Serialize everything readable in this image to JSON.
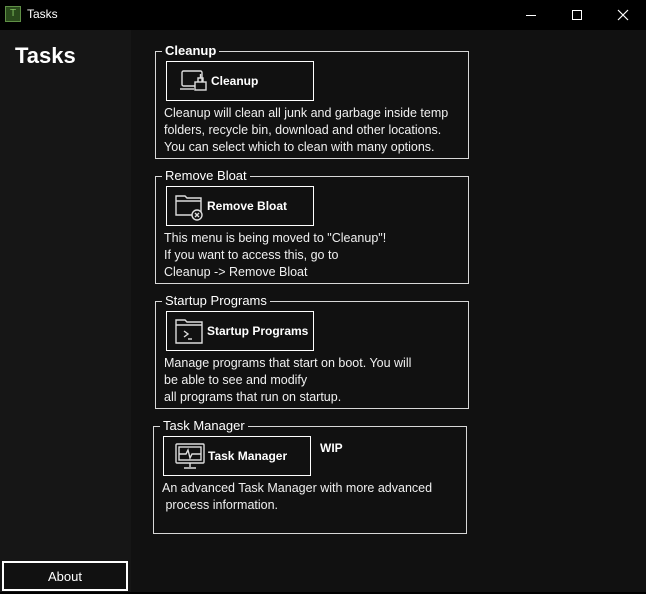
{
  "window": {
    "title": "Tasks",
    "app_icon_letter": "T",
    "controls": [
      "minimize",
      "maximize",
      "close"
    ]
  },
  "sidebar": {
    "title": "Tasks",
    "about_label": "About"
  },
  "groups": [
    {
      "legend": "Cleanup",
      "button_label": "Cleanup",
      "icon": "laptop-brush-icon",
      "description": "Cleanup will clean all junk and garbage inside temp\nfolders, recycle bin, download and other locations.\nYou can select which to clean with many options."
    },
    {
      "legend": "Remove Bloat",
      "button_label": "Remove Bloat",
      "icon": "folder-remove-icon",
      "description": "This menu is being moved to \"Cleanup\"!\nIf you want to access this, go to\nCleanup -> Remove Bloat"
    },
    {
      "legend": "Startup Programs",
      "button_label": "Startup Programs",
      "icon": "folder-terminal-icon",
      "description": "Manage programs that start on boot. You will\nbe able to see and modify\nall programs that run on startup."
    },
    {
      "legend": "Task Manager",
      "button_label": "Task Manager",
      "icon": "monitor-pulse-icon",
      "badge": "WIP",
      "description": "An advanced Task Manager with more advanced\n process information."
    }
  ]
}
